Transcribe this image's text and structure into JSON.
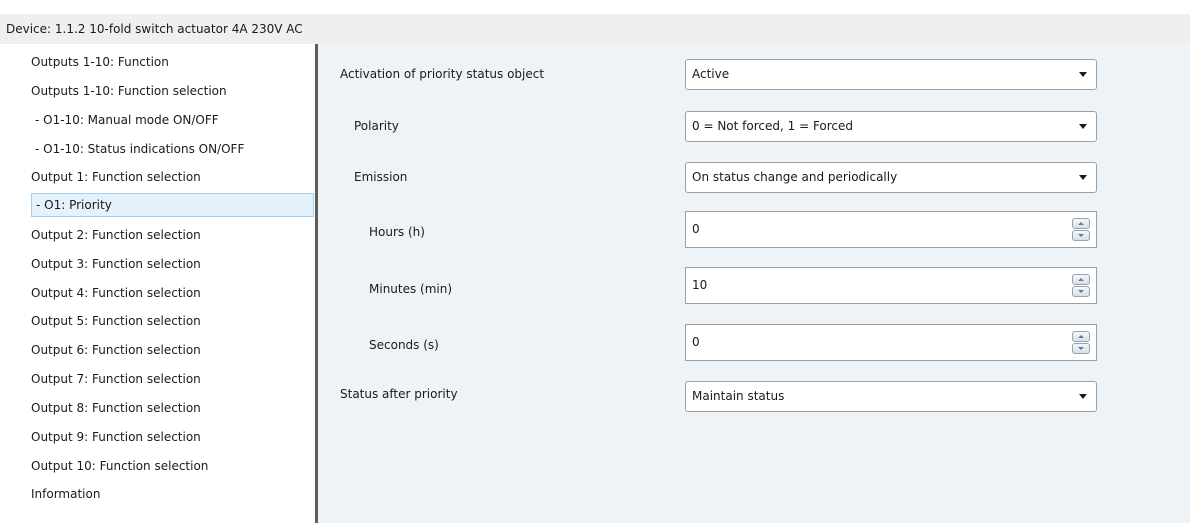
{
  "window": {
    "title": "Device: 1.1.2  10-fold switch actuator 4A 230V AC"
  },
  "sidebar": {
    "items": [
      {
        "label": "Outputs 1-10: Function"
      },
      {
        "label": "Outputs 1-10: Function selection"
      },
      {
        "label": "- O1-10: Manual mode ON/OFF"
      },
      {
        "label": "- O1-10: Status indications ON/OFF"
      },
      {
        "label": "Output 1: Function selection"
      },
      {
        "label": "- O1: Priority",
        "selected": true
      },
      {
        "label": "Output 2: Function selection"
      },
      {
        "label": "Output 3: Function selection"
      },
      {
        "label": "Output 4: Function selection"
      },
      {
        "label": "Output 5: Function selection"
      },
      {
        "label": "Output 6: Function selection"
      },
      {
        "label": "Output 7: Function selection"
      },
      {
        "label": "Output 8: Function selection"
      },
      {
        "label": "Output 9: Function selection"
      },
      {
        "label": "Output 10: Function selection"
      },
      {
        "label": "Information"
      }
    ]
  },
  "params": {
    "activation": {
      "label": "Activation of priority status object",
      "value": "Active"
    },
    "polarity": {
      "label": "Polarity",
      "value": "0 = Not forced, 1 = Forced"
    },
    "emission": {
      "label": "Emission",
      "value": "On status change and periodically"
    },
    "hours": {
      "label": "Hours (h)",
      "value": "0"
    },
    "minutes": {
      "label": "Minutes (min)",
      "value": "10"
    },
    "seconds": {
      "label": "Seconds (s)",
      "value": "0"
    },
    "status_after": {
      "label": "Status after priority",
      "value": "Maintain status"
    }
  },
  "icons": {
    "dropdown": "chevron-down-icon",
    "spin_up": "arrow-up-icon",
    "spin_down": "arrow-down-icon"
  },
  "colors": {
    "selection_bg": "#e5f1fb",
    "selection_border": "#a8cfec",
    "content_bg": "#eef3f7"
  }
}
